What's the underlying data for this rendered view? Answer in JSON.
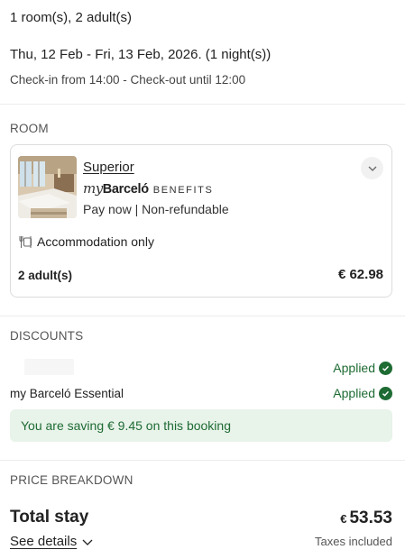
{
  "summary": {
    "rooms_guests": "1 room(s), 2 adult(s)",
    "dates": "Thu, 12 Feb - Fri, 13 Feb, 2026. (1 night(s))",
    "checkin_checkout": "Check-in from 14:00 - Check-out until 12:00"
  },
  "room_section": {
    "title": "ROOM",
    "room_name": "Superior",
    "brand_my": "my",
    "brand_name": "Barceló",
    "brand_benefits": "BENEFITS",
    "rate": "Pay now | Non-refundable",
    "board": "Accommodation only",
    "board_icon": "cutlery-icon",
    "guests": "2 adult(s)",
    "price": "€ 62.98",
    "expand_icon": "chevron-down-icon"
  },
  "discounts": {
    "title": "DISCOUNTS",
    "items": [
      {
        "label": "",
        "status": "Applied"
      },
      {
        "label": "my Barceló Essential",
        "status": "Applied"
      }
    ],
    "saving_message": "You are saving € 9.45 on this booking"
  },
  "price_breakdown": {
    "title": "PRICE BREAKDOWN",
    "total_label": "Total stay",
    "currency": "€",
    "total_amount": "53.53",
    "see_details": "See details",
    "taxes_note": "Taxes included"
  },
  "colors": {
    "success": "#1e6b33",
    "success_bg": "#e8f3ea",
    "divider": "#ececec"
  }
}
